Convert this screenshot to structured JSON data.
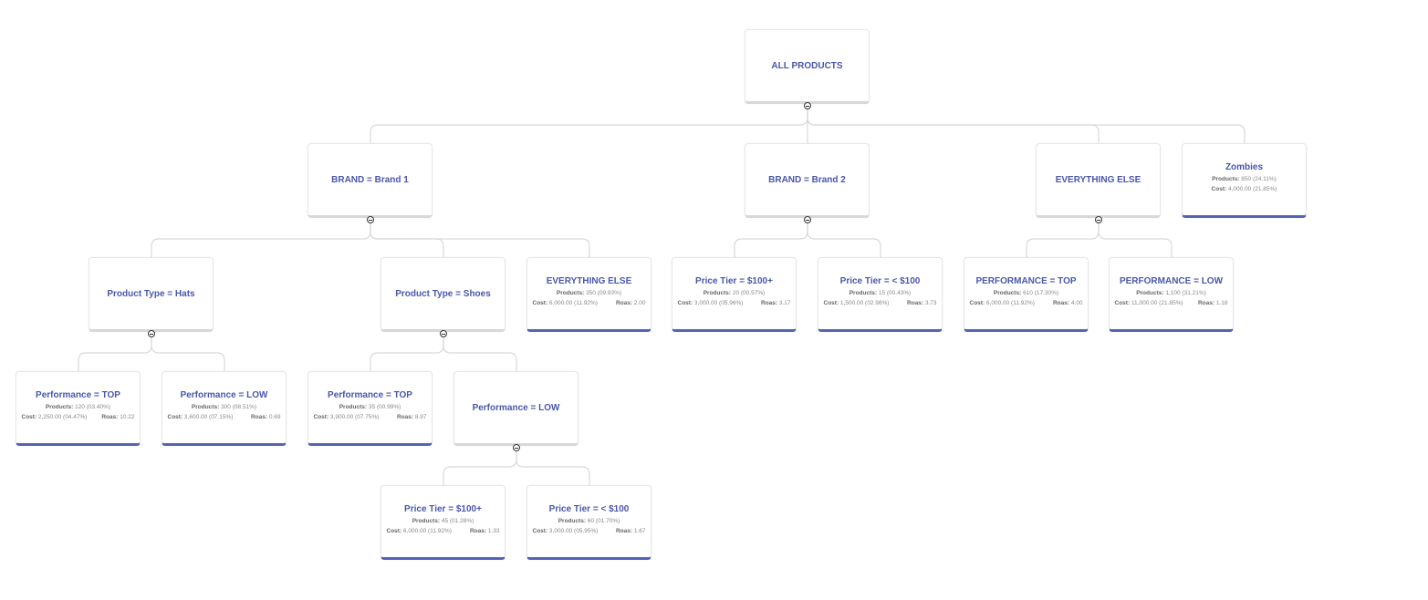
{
  "labels": {
    "products": "Products:",
    "cost": "Cost:",
    "roas": "Roas:"
  },
  "colors": {
    "title": "#4a57a6",
    "leaf_bar": "#5464b4",
    "branch_bar": "#d8d8d8",
    "link": "#d9d9d9"
  },
  "nodes": [
    {
      "id": "root",
      "parent": null,
      "title": "ALL PRODUCTS",
      "type": "branch",
      "expanded": true
    },
    {
      "id": "brand1",
      "parent": "root",
      "title": "BRAND = Brand 1",
      "type": "branch",
      "expanded": true
    },
    {
      "id": "brand2",
      "parent": "root",
      "title": "BRAND = Brand 2",
      "type": "branch",
      "expanded": true
    },
    {
      "id": "else1",
      "parent": "root",
      "title": "EVERYTHING ELSE",
      "type": "branch",
      "expanded": true
    },
    {
      "id": "zombies",
      "parent": "root",
      "title": "Zombies",
      "type": "leaf",
      "products": "850 (24.11%)",
      "cost": "4,000.00 (21.85%)",
      "roas": null
    },
    {
      "id": "hats",
      "parent": "brand1",
      "title": "Product Type = Hats",
      "type": "branch",
      "expanded": true
    },
    {
      "id": "shoes",
      "parent": "brand1",
      "title": "Product Type = Shoes",
      "type": "branch",
      "expanded": true
    },
    {
      "id": "b1else",
      "parent": "brand1",
      "title": "EVERYTHING ELSE",
      "type": "leaf",
      "products": "350 (09.93%)",
      "cost": "6,000.00 (11.92%)",
      "roas": "2.00"
    },
    {
      "id": "b2high",
      "parent": "brand2",
      "title": "Price Tier = $100+",
      "type": "leaf",
      "products": "20 (00.57%)",
      "cost": "3,000.00 (05.96%)",
      "roas": "3.17"
    },
    {
      "id": "b2low",
      "parent": "brand2",
      "title": "Price Tier = < $100",
      "type": "leaf",
      "products": "15 (00.43%)",
      "cost": "1,500.00 (02.98%)",
      "roas": "3.73"
    },
    {
      "id": "elsetop",
      "parent": "else1",
      "title": "PERFORMANCE = TOP",
      "type": "leaf",
      "products": "610 (17.30%)",
      "cost": "6,000.00 (11.92%)",
      "roas": "4.00"
    },
    {
      "id": "elselow",
      "parent": "else1",
      "title": "PERFORMANCE = LOW",
      "type": "leaf",
      "products": "1,100 (31.21%)",
      "cost": "11,000.00 (21.85%)",
      "roas": "1.18"
    },
    {
      "id": "hatstop",
      "parent": "hats",
      "title": "Performance = TOP",
      "type": "leaf",
      "products": "120 (03.40%)",
      "cost": "2,250.00 (04.47%)",
      "roas": "10.22"
    },
    {
      "id": "hatslow",
      "parent": "hats",
      "title": "Performance = LOW",
      "type": "leaf",
      "products": "300 (08.51%)",
      "cost": "3,600.00 (07.15%)",
      "roas": "0.69"
    },
    {
      "id": "shoestop",
      "parent": "shoes",
      "title": "Performance = TOP",
      "type": "leaf",
      "products": "35 (00.99%)",
      "cost": "3,900.00 (07.75%)",
      "roas": "8.97"
    },
    {
      "id": "shoeslow",
      "parent": "shoes",
      "title": "Performance = LOW",
      "type": "branch",
      "expanded": true
    },
    {
      "id": "slhigh",
      "parent": "shoeslow",
      "title": "Price Tier = $100+",
      "type": "leaf",
      "products": "45 (01.28%)",
      "cost": "6,000.00 (11.92%)",
      "roas": "1.33"
    },
    {
      "id": "sllow",
      "parent": "shoeslow",
      "title": "Price Tier = < $100",
      "type": "leaf",
      "products": "60 (01.70%)",
      "cost": "3,000.00 (05.95%)",
      "roas": "1.67"
    }
  ]
}
